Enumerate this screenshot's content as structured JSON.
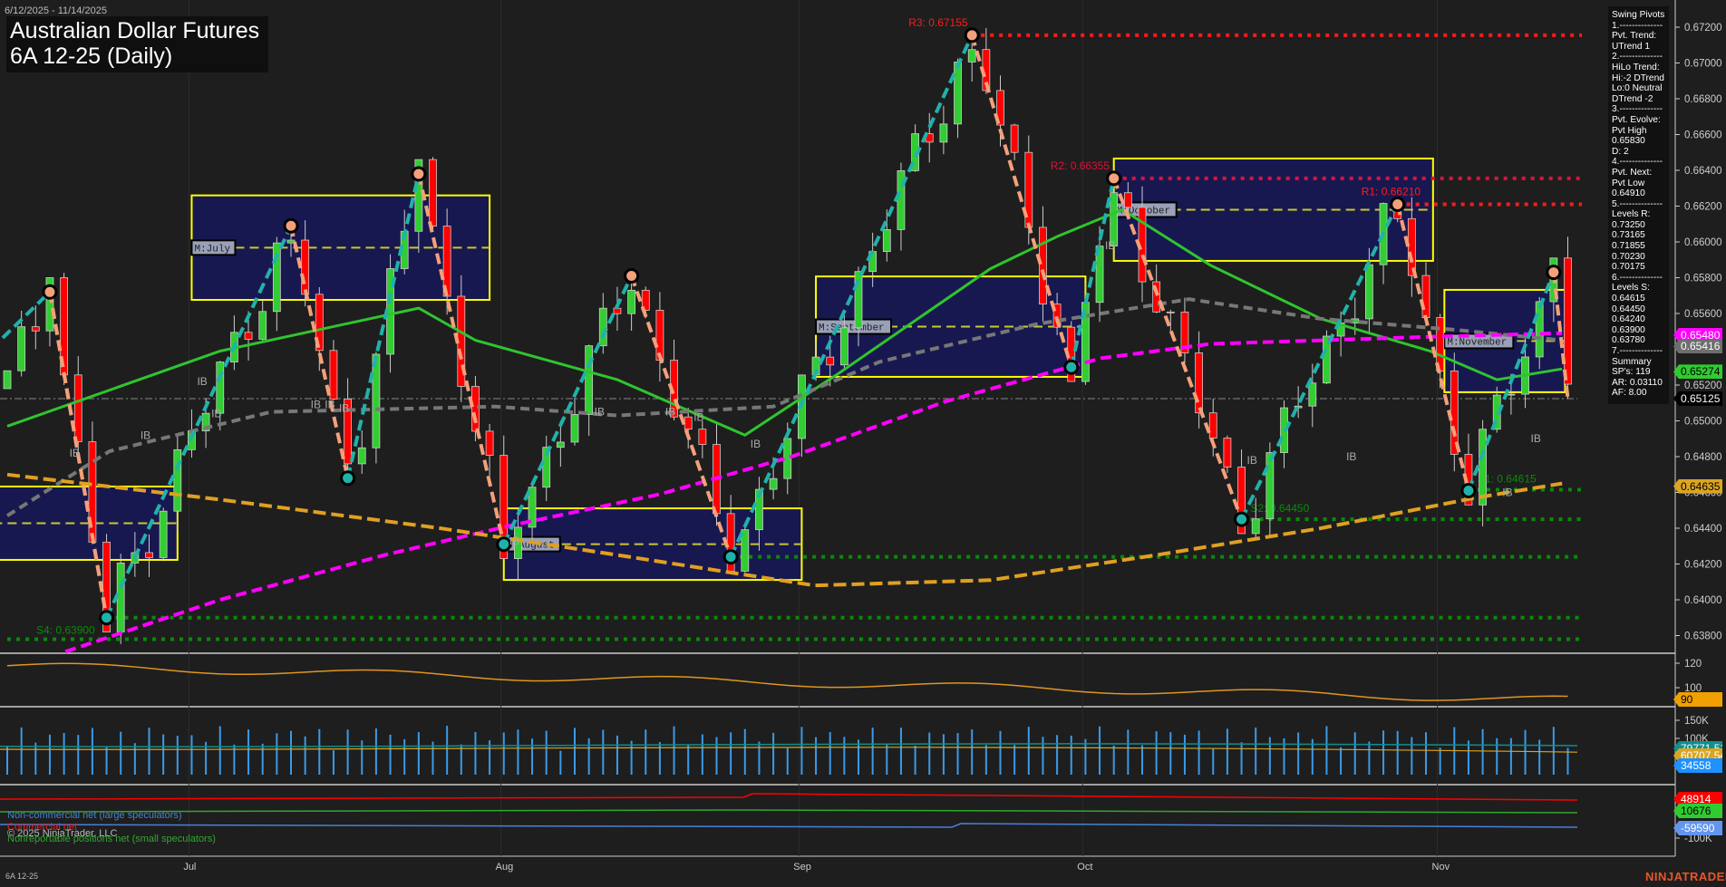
{
  "header": {
    "date_range": "6/12/2025 - 11/14/2025",
    "title_line1": "Australian Dollar Futures",
    "title_line2": "6A 12-25 (Daily)"
  },
  "info_panel": {
    "lines": [
      "Swing Pivots",
      "1.--------------",
      "Pvt. Trend:",
      "UTrend 1",
      "2.--------------",
      "HiLo Trend:",
      "Hi:-2 DTrend",
      "Lo:0 Neutral",
      "DTrend -2",
      "3.--------------",
      "Pvt. Evolve:",
      "Pvt High",
      "0.65830",
      "D: 2",
      "4.--------------",
      "Pvt. Next:",
      "Pvt Low",
      "0.64910",
      "5.--------------",
      "Levels R:",
      "0.73250",
      "0.73165",
      "0.71855",
      "0.70230",
      "0.70175",
      "6.--------------",
      "Levels S:",
      "0.64615",
      "0.64450",
      "0.64240",
      "0.63900",
      "0.63780",
      "7.--------------",
      "Summary",
      "SP's: 119",
      "AR: 0.03110",
      "AF: 8.00"
    ]
  },
  "chart_data": {
    "type": "candlestick",
    "title": "Australian Dollar Futures 6A 12-25 (Daily)",
    "ylim": [
      0.637,
      0.673
    ],
    "y_ticks": [
      "0.67200",
      "0.67000",
      "0.66800",
      "0.66600",
      "0.66400",
      "0.66200",
      "0.66000",
      "0.65800",
      "0.65600",
      "0.65400",
      "0.65200",
      "0.65000",
      "0.64800",
      "0.64600",
      "0.64400",
      "0.64200",
      "0.64000",
      "0.63800"
    ],
    "x_ticks": [
      {
        "label": "Jul",
        "day": 13
      },
      {
        "label": "Aug",
        "day": 35
      },
      {
        "label": "Sep",
        "day": 56
      },
      {
        "label": "Oct",
        "day": 76
      },
      {
        "label": "Nov",
        "day": 101
      }
    ],
    "days": 111,
    "swing_pivots": [
      [
        0,
        0.652
      ],
      [
        3,
        0.6572
      ],
      [
        7,
        0.639
      ],
      [
        20,
        0.6609
      ],
      [
        24,
        0.6468
      ],
      [
        29,
        0.6638
      ],
      [
        35,
        0.6431
      ],
      [
        44,
        0.6581
      ],
      [
        51,
        0.6424
      ],
      [
        68,
        0.67155
      ],
      [
        75,
        0.653
      ],
      [
        78,
        0.66355
      ],
      [
        87,
        0.6445
      ],
      [
        98,
        0.6621
      ],
      [
        103,
        0.6461
      ],
      [
        109,
        0.6583
      ],
      [
        110,
        0.65125
      ]
    ],
    "levels": [
      {
        "label": "R3: 0.67155",
        "price": 0.67155,
        "from": 68,
        "color": "#ff1a1a"
      },
      {
        "label": "R2: 0.66355",
        "price": 0.66355,
        "from": 78,
        "color": "#e0103c"
      },
      {
        "label": "R1: 0.66210",
        "price": 0.6621,
        "from": 98,
        "color": "#ff1a1a"
      },
      {
        "label": "S1: 0.64615",
        "price": 0.64615,
        "from": 103,
        "color": "#0a8a0a"
      },
      {
        "label": "S2: 0.64450",
        "price": 0.6445,
        "from": 87,
        "color": "#0a8a0a"
      },
      {
        "label": "",
        "price": 0.6424,
        "from": 51,
        "color": "#0a8a0a"
      },
      {
        "label": "",
        "price": 0.639,
        "from": 7,
        "color": "#0a8a0a"
      },
      {
        "label": "S4: 0.63900",
        "price": 0.6378,
        "from": 0,
        "color": "#0a8a0a"
      }
    ],
    "month_boxes": [
      {
        "label": "",
        "from": -1,
        "to": 12,
        "hi": 0.64633,
        "lo": 0.64223
      },
      {
        "label": "M:July",
        "from": 13,
        "to": 34,
        "hi": 0.6626,
        "lo": 0.65676
      },
      {
        "label": "M:August",
        "from": 35,
        "to": 56,
        "hi": 0.64511,
        "lo": 0.64111
      },
      {
        "label": "M:September",
        "from": 57,
        "to": 76,
        "hi": 0.65807,
        "lo": 0.65246
      },
      {
        "label": "M:October",
        "from": 78,
        "to": 100.5,
        "hi": 0.66466,
        "lo": 0.65894
      },
      {
        "label": "M:November",
        "from": 101.3,
        "to": 109.8,
        "hi": 0.65732,
        "lo": 0.6516
      }
    ],
    "ib_labels": [
      [
        4,
        0.648
      ],
      [
        9,
        0.649
      ],
      [
        13,
        0.652
      ],
      [
        14,
        0.6502
      ],
      [
        21,
        0.6507
      ],
      [
        22,
        0.6507
      ],
      [
        23,
        0.6505
      ],
      [
        35,
        0.6431
      ],
      [
        41,
        0.6503
      ],
      [
        46,
        0.6503
      ],
      [
        48,
        0.65
      ],
      [
        52,
        0.6485
      ],
      [
        77,
        0.6596
      ],
      [
        87,
        0.6476
      ],
      [
        94,
        0.6478
      ],
      [
        105,
        0.6458
      ],
      [
        107,
        0.6488
      ]
    ],
    "moving_averages": [
      {
        "name": "fast",
        "color": "#2fc42f",
        "dash": "",
        "points": [
          [
            0,
            0.6497
          ],
          [
            15,
            0.6539
          ],
          [
            29,
            0.6563
          ],
          [
            33,
            0.6545
          ],
          [
            43,
            0.6523
          ],
          [
            52,
            0.6492
          ],
          [
            58.5,
            0.6526
          ],
          [
            69.3,
            0.6585
          ],
          [
            74,
            0.6603
          ],
          [
            78.6,
            0.6618
          ],
          [
            84.8,
            0.6587
          ],
          [
            92.6,
            0.6557
          ],
          [
            100.3,
            0.6539
          ],
          [
            105,
            0.6523
          ],
          [
            109.6,
            0.6529
          ]
        ]
      },
      {
        "name": "slow",
        "color": "#777777",
        "dash": "10,6",
        "points": [
          [
            0,
            0.6447
          ],
          [
            7.2,
            0.6483
          ],
          [
            18.6,
            0.6505
          ],
          [
            34.4,
            0.6508
          ],
          [
            43,
            0.6503
          ],
          [
            54,
            0.6508
          ],
          [
            61.5,
            0.6533
          ],
          [
            72.5,
            0.6554
          ],
          [
            83.3,
            0.6568
          ],
          [
            92.6,
            0.6557
          ],
          [
            101.9,
            0.6551
          ],
          [
            109.6,
            0.6545
          ]
        ]
      },
      {
        "name": "long",
        "color": "#ff00ff",
        "dash": "12,6",
        "points": [
          [
            4.1,
            0.6371
          ],
          [
            15,
            0.64
          ],
          [
            26.6,
            0.6425
          ],
          [
            35.2,
            0.6441
          ],
          [
            46,
            0.6459
          ],
          [
            55.3,
            0.648
          ],
          [
            66.2,
            0.6511
          ],
          [
            77.1,
            0.6535
          ],
          [
            84.8,
            0.6543
          ],
          [
            100.3,
            0.6547
          ],
          [
            109.6,
            0.6549
          ]
        ]
      },
      {
        "name": "longest",
        "color": "#e0a020",
        "dash": "14,6",
        "points": [
          [
            0,
            0.647
          ],
          [
            15,
            0.6456
          ],
          [
            30.5,
            0.644
          ],
          [
            43,
            0.6425
          ],
          [
            56.9,
            0.6408
          ],
          [
            69.3,
            0.6411
          ],
          [
            81,
            0.6425
          ],
          [
            92.6,
            0.644
          ],
          [
            103.5,
            0.6457
          ],
          [
            109.6,
            0.6465
          ]
        ]
      }
    ],
    "price_tags": [
      {
        "value": "0.65480",
        "price": 0.6548,
        "bg": "#ff00ff",
        "fg": "#ffffff"
      },
      {
        "value": "0.65416",
        "price": 0.65416,
        "bg": "#6e6e6e",
        "fg": "#ffffff"
      },
      {
        "value": "0.65274",
        "price": 0.65274,
        "bg": "#2ecc2e",
        "fg": "#000000"
      },
      {
        "value": "0.65125",
        "price": 0.65125,
        "bg": "#000000",
        "fg": "#ffffff"
      },
      {
        "value": "0.64635",
        "price": 0.64635,
        "bg": "#daa520",
        "fg": "#000000"
      }
    ],
    "indicator_panel": {
      "ticks": [
        "120",
        "100"
      ],
      "tag": "90",
      "series_start": 118,
      "series_end": 90
    },
    "volume_panel": {
      "ticks": [
        "150K",
        "100K"
      ],
      "tags": [
        {
          "value": "79771.51",
          "bg": "#0f8f8f"
        },
        {
          "value": "60707.54",
          "bg": "#daa520"
        },
        {
          "value": "34558",
          "bg": "#1e90ff"
        }
      ]
    },
    "cot_panel": {
      "ticks": [
        "-100K"
      ],
      "tags": [
        {
          "value": "48914",
          "bg": "#ff0000"
        },
        {
          "value": "10676",
          "bg": "#2ecc2e"
        },
        {
          "value": "-59590",
          "bg": "#6495ed"
        }
      ]
    }
  },
  "legend": {
    "noncommercial": "Non-commercial net (large speculators)",
    "commercial": "Commercial net",
    "copyright": "© 2025 NinjaTrader, LLC",
    "nonreportable": "Nonreportable positions net (small speculators)"
  },
  "footer": {
    "instrument": "6A 12-25",
    "logo": "NINJATRADER"
  }
}
